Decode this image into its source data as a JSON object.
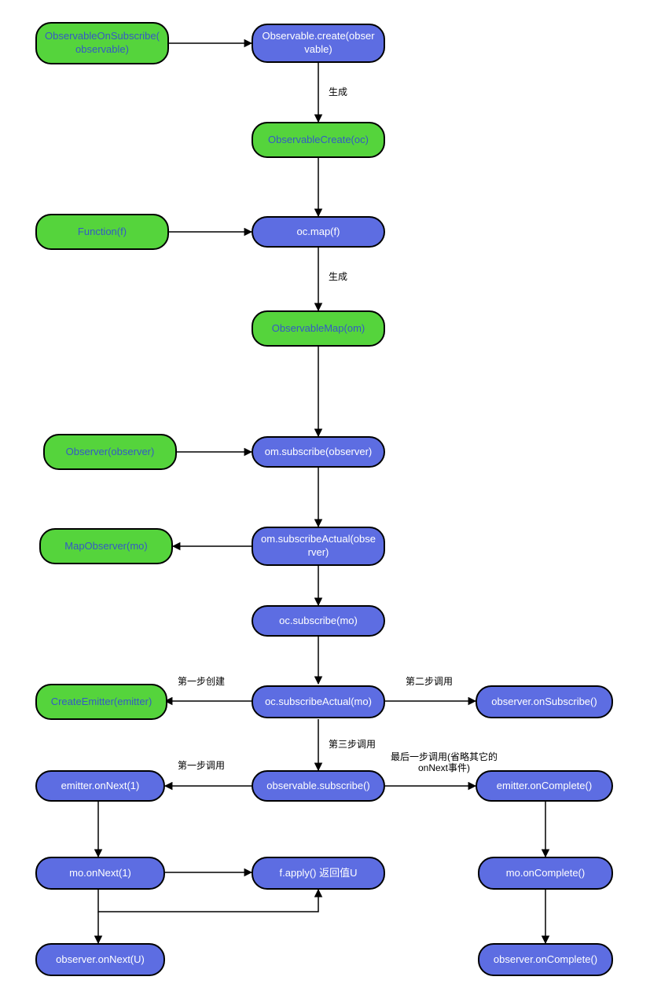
{
  "nodes": {
    "n_obs_on_sub": {
      "label": "ObservableOnSubscribe(observable)",
      "color": "green"
    },
    "n_obs_create": {
      "label": "Observable.create(observable)",
      "color": "blue"
    },
    "n_oc": {
      "label": "ObservableCreate(oc)",
      "color": "green"
    },
    "n_func": {
      "label": "Function(f)",
      "color": "green"
    },
    "n_ocmap": {
      "label": "oc.map(f)",
      "color": "blue"
    },
    "n_om": {
      "label": "ObservableMap(om)",
      "color": "green"
    },
    "n_observer": {
      "label": "Observer(observer)",
      "color": "green"
    },
    "n_omsub": {
      "label": "om.subscribe(observer)",
      "color": "blue"
    },
    "n_mapobs": {
      "label": "MapObserver(mo)",
      "color": "green"
    },
    "n_omsubact": {
      "label": "om.subscribeActual(observer)",
      "color": "blue"
    },
    "n_ocsub": {
      "label": "oc.subscribe(mo)",
      "color": "blue"
    },
    "n_emitter": {
      "label": "CreateEmitter(emitter)",
      "color": "green"
    },
    "n_ocsubact": {
      "label": "oc.subscribeActual(mo)",
      "color": "blue"
    },
    "n_obsonSub": {
      "label": "observer.onSubscribe()",
      "color": "blue"
    },
    "n_emitNext": {
      "label": "emitter.onNext(1)",
      "color": "blue"
    },
    "n_obsSub": {
      "label": "observable.subscribe()",
      "color": "blue"
    },
    "n_emitComp": {
      "label": "emitter.onComplete()",
      "color": "blue"
    },
    "n_moNext": {
      "label": "mo.onNext(1)",
      "color": "blue"
    },
    "n_fapply": {
      "label": "f.apply() 返回值U",
      "color": "blue"
    },
    "n_moComp": {
      "label": "mo.onComplete()",
      "color": "blue"
    },
    "n_obsNext": {
      "label": "observer.onNext(U)",
      "color": "blue"
    },
    "n_obsComp": {
      "label": "observer.onComplete()",
      "color": "blue"
    }
  },
  "edgeLabels": {
    "l_gen1": "生成",
    "l_gen2": "生成",
    "l_step1create": "第一步创建",
    "l_step2call": "第二步调用",
    "l_step3call": "第三步调用",
    "l_step1call": "第一步调用",
    "l_lastcall": "最后一步调用(省略其它的onNext事件)"
  }
}
